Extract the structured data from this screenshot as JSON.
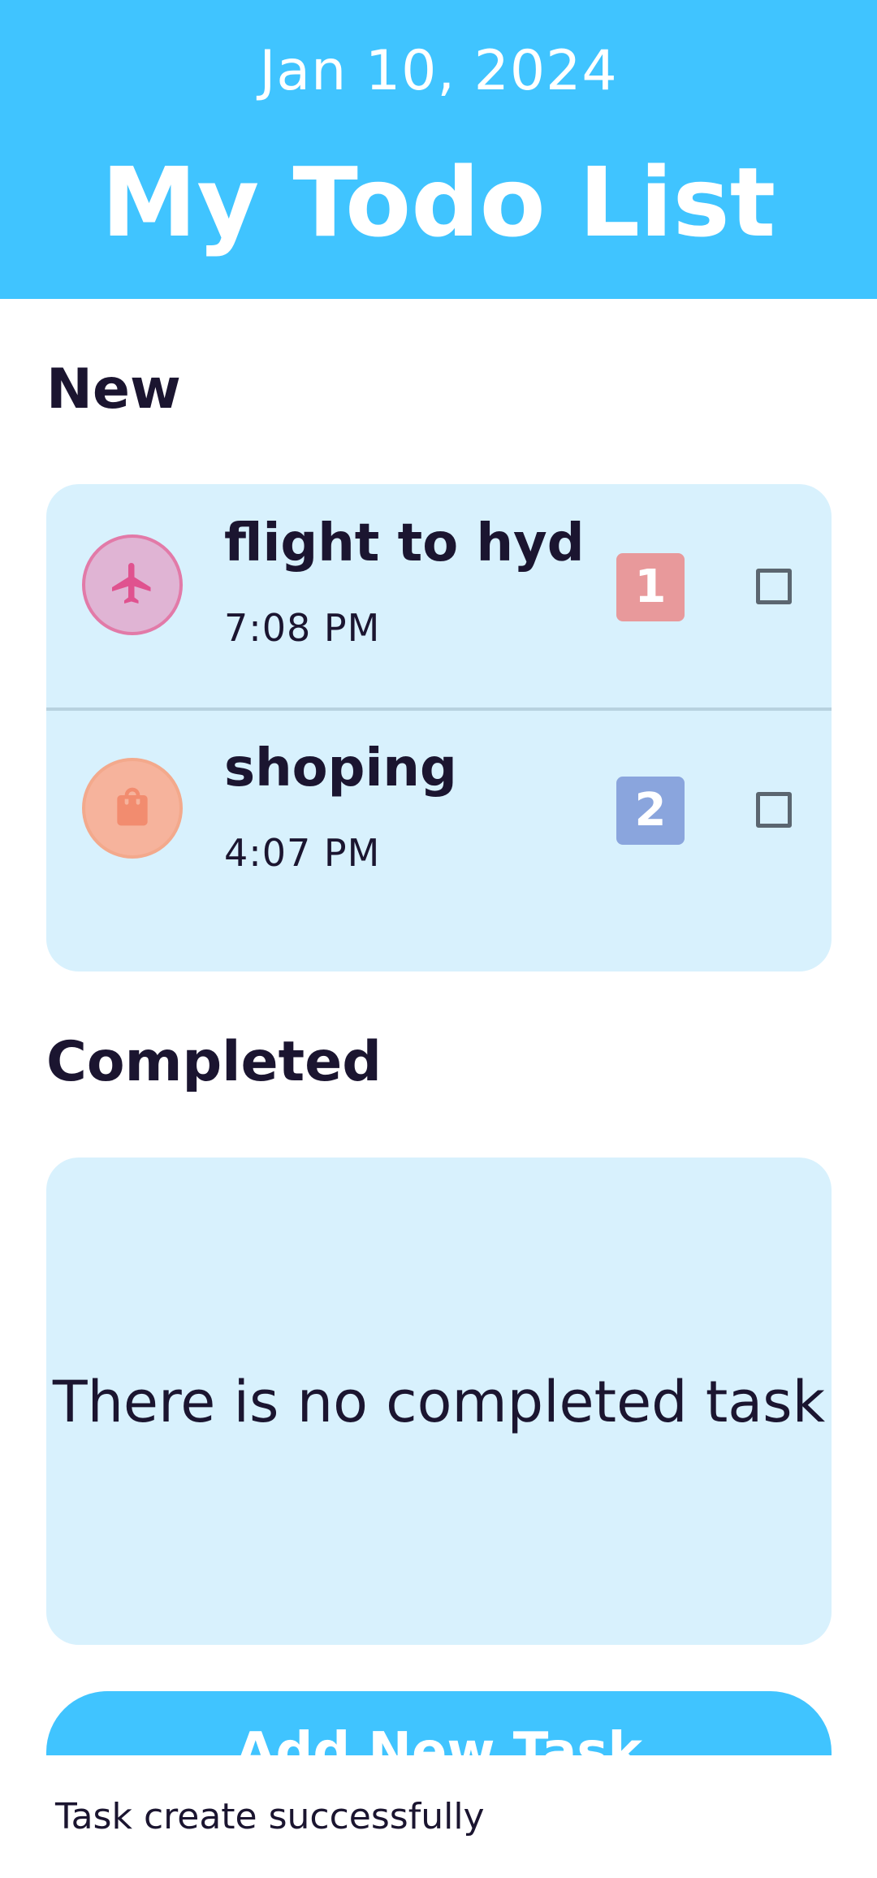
{
  "header": {
    "date": "Jan 10, 2024",
    "title": "My Todo List",
    "background_color": "#40c4ff"
  },
  "sections": {
    "new_label": "New",
    "completed_label": "Completed"
  },
  "tasks": [
    {
      "title": "flight to hyd",
      "time": "7:08 PM",
      "category_icon": "airplane-icon",
      "category_color": "#e27aa8",
      "priority": "1",
      "priority_color": "#e8999b",
      "completed": false
    },
    {
      "title": "shoping",
      "time": "4:07 PM",
      "category_icon": "shopping-bag-icon",
      "category_color": "#f28c6f",
      "priority": "2",
      "priority_color": "#8aa5dd",
      "completed": false
    }
  ],
  "completed_empty_text": "There is no completed task",
  "add_button_label": "Add New Task",
  "toast_message": "Task create successfully"
}
